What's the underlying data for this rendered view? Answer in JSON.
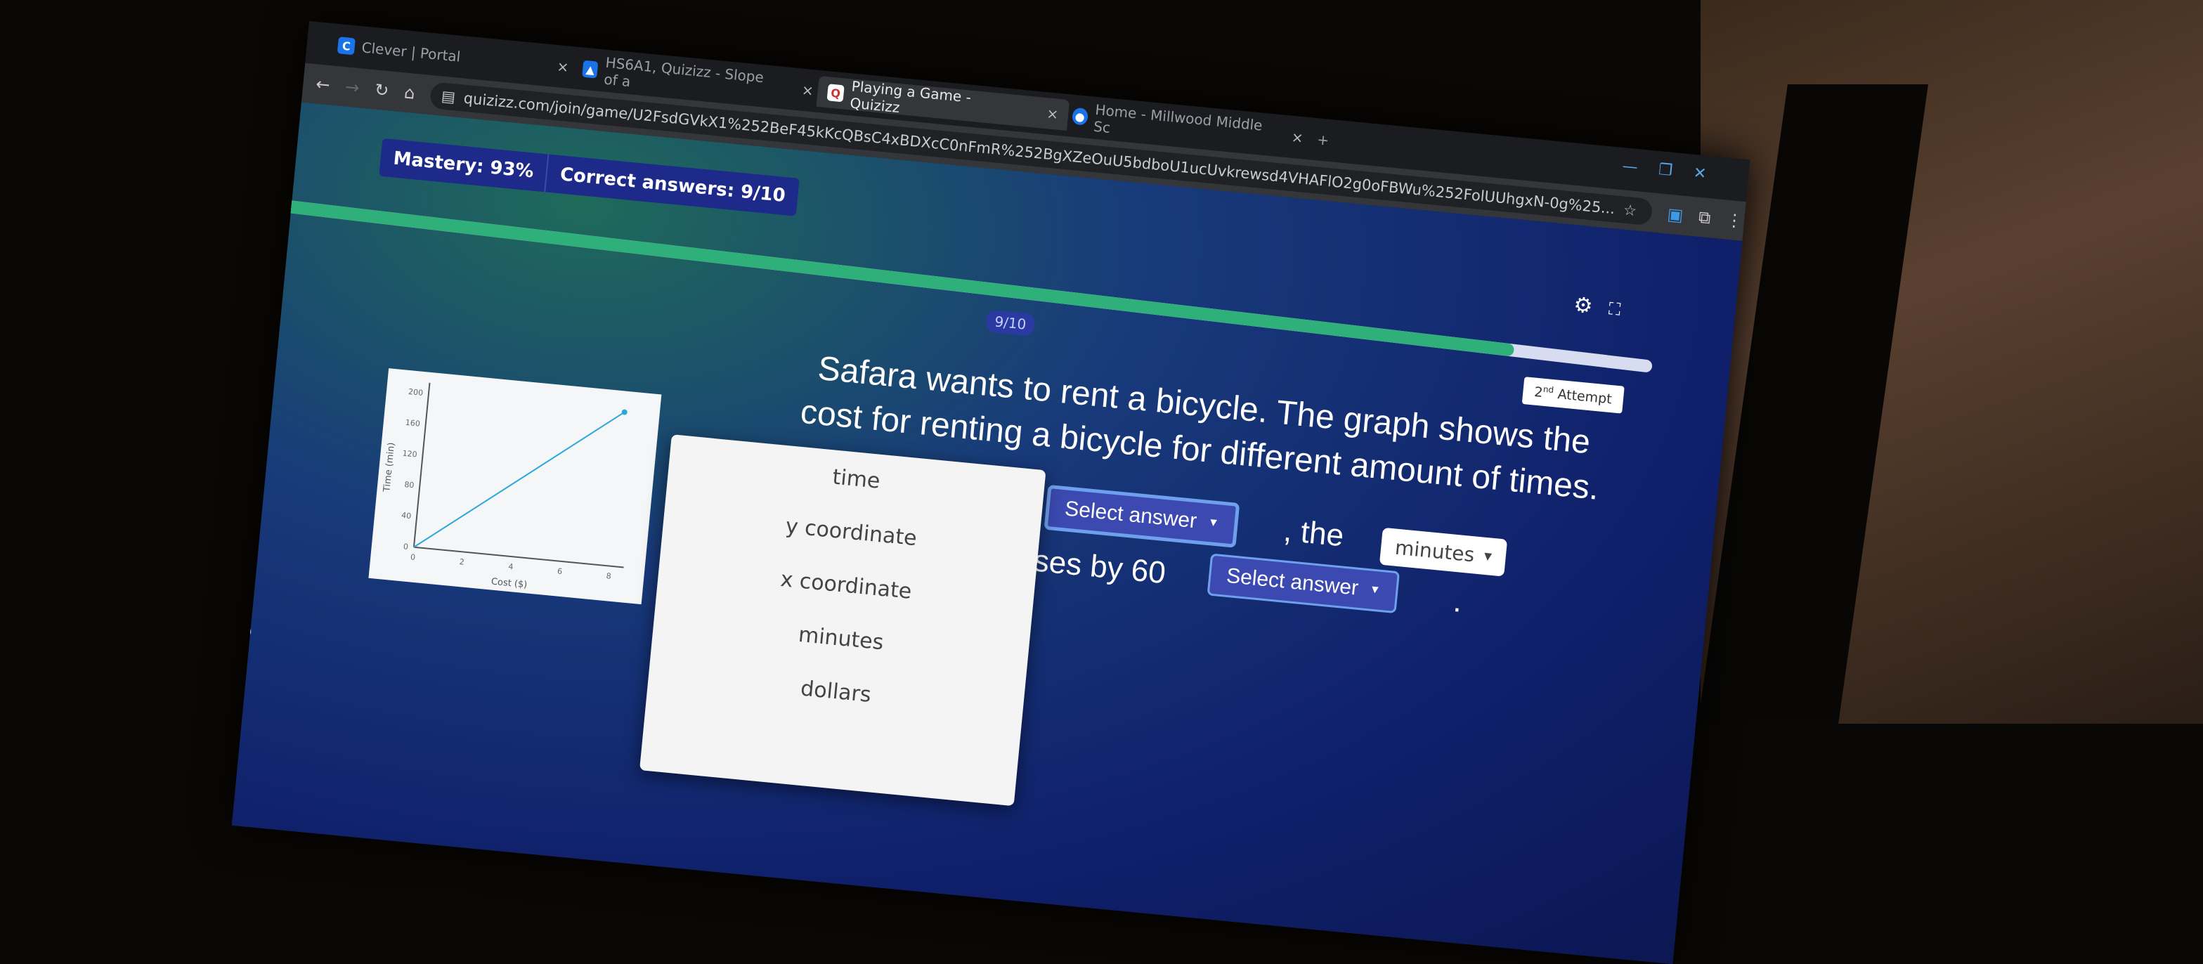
{
  "browser": {
    "tabs": [
      {
        "label": "Clever | Portal",
        "icon": "clever-icon"
      },
      {
        "label": "HS6A1, Quizizz - Slope of a",
        "icon": "classroom-icon"
      },
      {
        "label": "Playing a Game - Quizizz",
        "icon": "quizizz-icon",
        "active": true
      },
      {
        "label": "Home - Millwood Middle Sc",
        "icon": "school-icon"
      }
    ],
    "url": "quizizz.com/join/game/U2FsdGVkX1%252BeF45kKcQBsC4xBDXcC0nFmR%252BgXZeOuU5bdboU1ucUvkrewsd4VHAFlO2g0oFBWu%252FolUUhgxN-0g%25..."
  },
  "game": {
    "mastery": "Mastery: 93%",
    "correct": "Correct answers: 9/10",
    "progress_fraction": 0.9,
    "question_number": "9/10",
    "attempt_ordinal": "2",
    "attempt_suffix": "nd",
    "attempt_label": "Attempt",
    "question_line1": "Safara wants to rent a bicycle. The graph shows the",
    "question_line2": "cost for renting a bicycle for different amount of times.",
    "dropdown_options": [
      "time",
      "y coordinate",
      "x coordinate",
      "minutes",
      "dollars"
    ],
    "select1": "Select answer",
    "comma_the": ", the",
    "minutes_value": "minutes",
    "increases_text": "ses by 60",
    "select2": "Select answer",
    "period": ".",
    "colors": {
      "progress": "#2fb07a",
      "select": "#3b49b0",
      "background": "#0f1f6a"
    }
  },
  "chart_data": {
    "type": "line",
    "xlabel": "Cost ($)",
    "ylabel": "Time (min)",
    "xticks": [
      "0",
      "2",
      "4",
      "6",
      "8"
    ],
    "yticks": [
      "0",
      "40",
      "80",
      "120",
      "160",
      "200"
    ],
    "xlim": [
      0,
      8
    ],
    "ylim": [
      0,
      200
    ],
    "series": [
      {
        "x": [
          0,
          8
        ],
        "y": [
          0,
          200
        ]
      }
    ],
    "color": "#2aa8d8"
  }
}
